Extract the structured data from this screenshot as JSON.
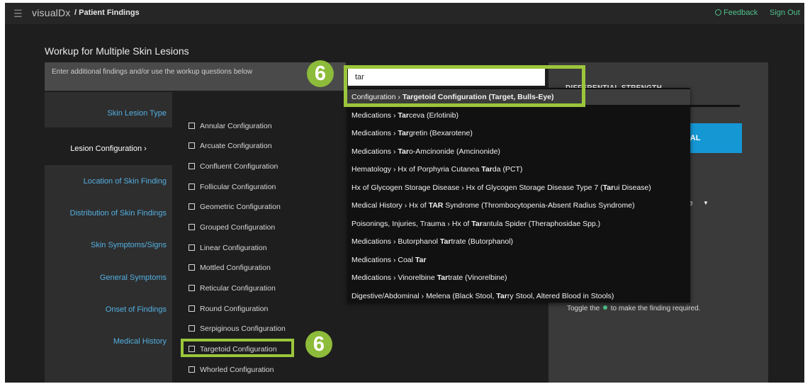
{
  "header": {
    "logo": "visualDx",
    "breadcrumb": "/ Patient Findings",
    "feedback": "Feedback",
    "sign_out": "Sign Out"
  },
  "page": {
    "title": "Workup for Multiple Skin Lesions",
    "instructions": "Enter additional findings and/or use the workup questions below"
  },
  "search": {
    "value": "tar"
  },
  "sidebar": {
    "items": [
      {
        "label": "Skin Lesion Type"
      },
      {
        "label": "Lesion Configuration ›"
      },
      {
        "label": "Location of Skin Finding"
      },
      {
        "label": "Distribution of Skin Findings"
      },
      {
        "label": "Skin Symptoms/Signs"
      },
      {
        "label": "General Symptoms"
      },
      {
        "label": "Onset of Findings"
      },
      {
        "label": "Medical History"
      }
    ]
  },
  "options": [
    {
      "label": "Annular Configuration"
    },
    {
      "label": "Arcuate Configuration"
    },
    {
      "label": "Confluent Configuration"
    },
    {
      "label": "Follicular Configuration"
    },
    {
      "label": "Geometric Configuration"
    },
    {
      "label": "Grouped Configuration"
    },
    {
      "label": "Linear Configuration"
    },
    {
      "label": "Mottled Configuration"
    },
    {
      "label": "Reticular Configuration"
    },
    {
      "label": "Round Configuration"
    },
    {
      "label": "Serpiginous Configuration"
    },
    {
      "label": "Targetoid Configuration"
    },
    {
      "label": "Whorled Configuration"
    }
  ],
  "dropdown": [
    {
      "cat": "Configuration",
      "pre": "",
      "match": "Targetoid Configuration (Target, Bulls-Eye)",
      "post": ""
    },
    {
      "cat": "Medications",
      "pre": "",
      "match": "Tar",
      "post": "ceva (Erlotinib)"
    },
    {
      "cat": "Medications",
      "pre": "",
      "match": "Tar",
      "post": "gretin (Bexarotene)"
    },
    {
      "cat": "Medications",
      "pre": "",
      "match": "Tar",
      "post": "o-Amcinonide (Amcinonide)"
    },
    {
      "cat": "Hematology",
      "pre": "Hx of Porphyria Cutanea ",
      "match": "Tar",
      "post": "da (PCT)"
    },
    {
      "cat": "Hx of Glycogen Storage Disease",
      "pre": "Hx of Glycogen Storage Disease Type 7 (",
      "match": "Tar",
      "post": "ui Disease)"
    },
    {
      "cat": "Medical History",
      "pre": "Hx of ",
      "match": "TAR",
      "post": " Syndrome (Thrombocytopenia-Absent Radius Syndrome)"
    },
    {
      "cat": "Poisonings, Injuries, Trauma",
      "pre": "Hx of ",
      "match": "Tar",
      "post": "antula Spider (Theraphosidae Spp.)"
    },
    {
      "cat": "Medications",
      "pre": "Butorphanol ",
      "match": "Tar",
      "post": "trate (Butorphanol)"
    },
    {
      "cat": "Medications",
      "pre": "Coal ",
      "match": "Tar",
      "post": ""
    },
    {
      "cat": "Medications",
      "pre": "Vinorelbine ",
      "match": "Tar",
      "post": "trate (Vinorelbine)"
    },
    {
      "cat": "Digestive/Abdominal",
      "pre": "Melena (Black Stool, ",
      "match": "Tar",
      "post": "ry Stool, Altered Blood in Stools)"
    }
  ],
  "right_panel": {
    "differential_label": "DIFFERENTIAL STRENGTH",
    "button_partial": "TIAL",
    "select_partial": "le",
    "toggle_pre": "Toggle the",
    "toggle_post": "to make the finding required."
  },
  "badges": {
    "search_step": "6",
    "option_step": "6"
  },
  "colors": {
    "accent_green": "#9bc63c",
    "link_blue": "#54b0e2",
    "button_blue": "#1597d4",
    "brand_green": "#4fc08d"
  }
}
